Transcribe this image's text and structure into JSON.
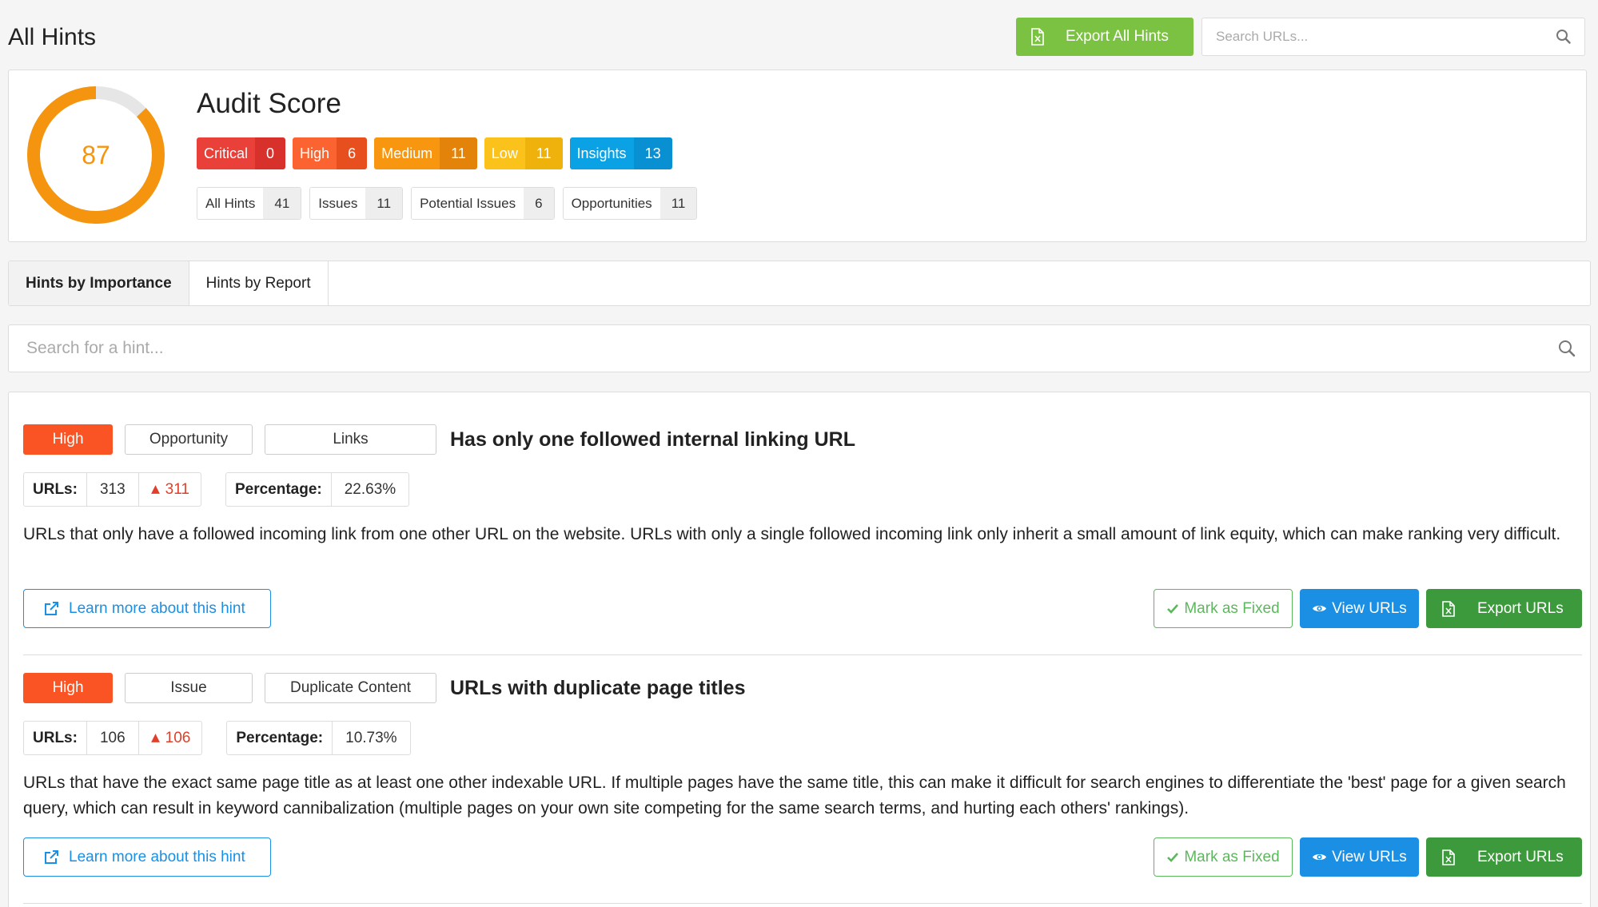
{
  "header": {
    "title": "All Hints",
    "export_all_label": "Export All Hints",
    "search_placeholder": "Search URLs..."
  },
  "audit": {
    "title": "Audit Score",
    "score": "87",
    "score_fraction": 0.87,
    "score_color": "#f5940e",
    "severity": [
      {
        "name": "Critical",
        "count": "0",
        "color": "#e9403a"
      },
      {
        "name": "High",
        "count": "6",
        "color": "#fb6330"
      },
      {
        "name": "Medium",
        "count": "11",
        "color": "#f9960f"
      },
      {
        "name": "Low",
        "count": "11",
        "color": "#fbc21c"
      },
      {
        "name": "Insights",
        "count": "13",
        "color": "#0aa1e5"
      }
    ],
    "counts": [
      {
        "name": "All Hints",
        "count": "41"
      },
      {
        "name": "Issues",
        "count": "11"
      },
      {
        "name": "Potential Issues",
        "count": "6"
      },
      {
        "name": "Opportunities",
        "count": "11"
      }
    ]
  },
  "tabs": [
    {
      "label": "Hints by Importance",
      "active": true
    },
    {
      "label": "Hints by Report",
      "active": false
    }
  ],
  "hint_search": {
    "placeholder": "Search for a hint..."
  },
  "hints": [
    {
      "priority": "High",
      "type": "Opportunity",
      "category": "Links",
      "title": "Has only one followed internal linking URL",
      "urls_label": "URLs:",
      "urls": "313",
      "urls_delta": "311",
      "pct_label": "Percentage:",
      "percentage": "22.63%",
      "description": "URLs that only have a followed incoming link from one other URL on the website. URLs with only a single followed incoming link only inherit a small amount of link equity, which can make ranking very difficult.",
      "learn_label": "Learn more about this hint",
      "fixed_label": "Mark as Fixed",
      "view_label": "View URLs",
      "export_label": "Export URLs"
    },
    {
      "priority": "High",
      "type": "Issue",
      "category": "Duplicate Content",
      "title": "URLs with duplicate page titles",
      "urls_label": "URLs:",
      "urls": "106",
      "urls_delta": "106",
      "pct_label": "Percentage:",
      "percentage": "10.73%",
      "description": "URLs that have the exact same page title as at least one other indexable URL. If multiple pages have the same title, this can make it difficult for search engines to differentiate the 'best' page for a given search query, which can result in keyword cannibalization (multiple pages on your own site competing for the same search terms, and hurting each others' rankings).",
      "learn_label": "Learn more about this hint",
      "fixed_label": "Mark as Fixed",
      "view_label": "View URLs",
      "export_label": "Export URLs"
    }
  ]
}
